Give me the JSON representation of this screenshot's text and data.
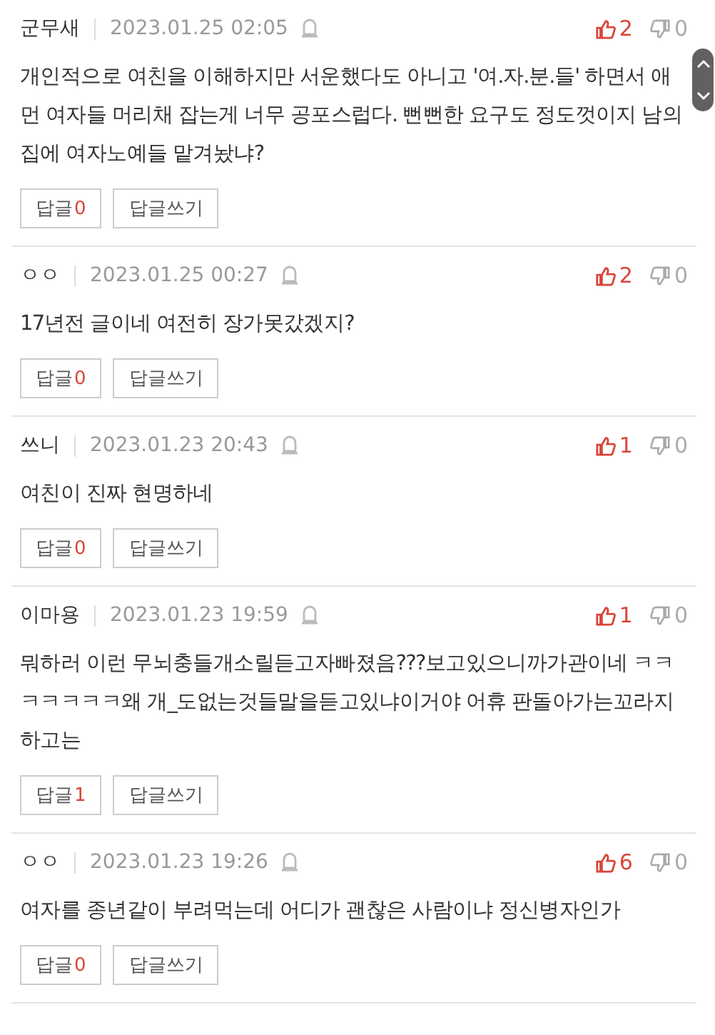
{
  "comments": [
    {
      "author": "군무새",
      "date": "2023.01.25 02:05",
      "likes": "2",
      "dislikes": "0",
      "text": "개인적으로 여친을 이해하지만 서운했다도 아니고 '여.자.분.들' 하면서 애먼 여자들 머리채 잡는게 너무 공포스럽다. 뻔뻔한 요구도 정도껏이지 남의집에 여자노예들 맡겨놨냐?",
      "reply_label": "답글",
      "reply_count": "0",
      "write_label": "답글쓰기"
    },
    {
      "author": "ㅇㅇ",
      "date": "2023.01.25 00:27",
      "likes": "2",
      "dislikes": "0",
      "text": "17년전 글이네 여전히 장가못갔겠지?",
      "reply_label": "답글",
      "reply_count": "0",
      "write_label": "답글쓰기"
    },
    {
      "author": "쓰니",
      "date": "2023.01.23 20:43",
      "likes": "1",
      "dislikes": "0",
      "text": "여친이 진짜 현명하네",
      "reply_label": "답글",
      "reply_count": "0",
      "write_label": "답글쓰기"
    },
    {
      "author": "이마용",
      "date": "2023.01.23 19:59",
      "likes": "1",
      "dislikes": "0",
      "text": "뭐하러 이런 무뇌충들개소릴듣고자빠졌음???보고있으니까가관이네 ㅋㅋㅋㅋㅋㅋㅋ왜 개_도없는것들말을듣고있냐이거야 어휴 판돌아가는꼬라지하고는",
      "reply_label": "답글",
      "reply_count": "1",
      "write_label": "답글쓰기"
    },
    {
      "author": "ㅇㅇ",
      "date": "2023.01.23 19:26",
      "likes": "6",
      "dislikes": "0",
      "text": "여자를 종년같이 부려먹는데 어디가 괜찮은 사람이냐 정신병자인가",
      "reply_label": "답글",
      "reply_count": "0",
      "write_label": "답글쓰기"
    }
  ]
}
